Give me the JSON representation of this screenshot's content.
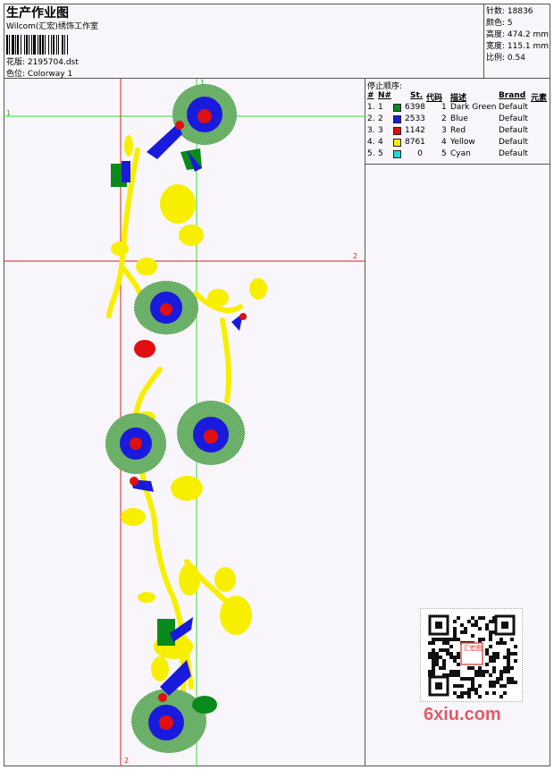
{
  "header": {
    "title": "生产作业图",
    "studio": "Wilcom(汇宏)绣饰工作室",
    "design_label": "花版: 2195704.dst",
    "colorway_label": "色位: Colorway 1"
  },
  "stats": [
    {
      "text": "针数: 18836"
    },
    {
      "text": "颜色: 5"
    },
    {
      "text": "高度: 474.2 mm"
    },
    {
      "text": "宽度: 115.1 mm"
    },
    {
      "text": "比例: 0.54"
    }
  ],
  "guides": {
    "label_1_top": "1",
    "label_1_left": "1",
    "label_2_right": "2",
    "label_2_bottom": "2"
  },
  "stop_panel": {
    "title": "停止顺序:",
    "headers": {
      "num": "#",
      "needle": "N#",
      "stitches": "St.",
      "code": "代码",
      "desc": "描述",
      "brand": "Brand",
      "element": "元素"
    },
    "rows": [
      {
        "num": "1.",
        "needle": "1",
        "color": "#0a8a1a",
        "stitches": "6398",
        "code": "1",
        "desc": "Dark Green",
        "brand": "Default"
      },
      {
        "num": "2.",
        "needle": "2",
        "color": "#1a1adc",
        "stitches": "2533",
        "code": "2",
        "desc": "Blue",
        "brand": "Default"
      },
      {
        "num": "3.",
        "needle": "3",
        "color": "#e01010",
        "stitches": "1142",
        "code": "3",
        "desc": "Red",
        "brand": "Default"
      },
      {
        "num": "4.",
        "needle": "4",
        "color": "#f7ee00",
        "stitches": "8761",
        "code": "4",
        "desc": "Yellow",
        "brand": "Default"
      },
      {
        "num": "5.",
        "needle": "5",
        "color": "#20d8d8",
        "stitches": "0",
        "code": "5",
        "desc": "Cyan",
        "brand": "Default"
      }
    ]
  },
  "watermark": {
    "text": "6xiu.com",
    "stamp": "汇宏图"
  },
  "colors": {
    "dark_green": "#0a8a1a",
    "light_green": "#7fbf78",
    "blue": "#1a1adc",
    "red": "#e01010",
    "yellow": "#f7ee00",
    "guide_red": "#e02020",
    "guide_green": "#33dd33"
  }
}
